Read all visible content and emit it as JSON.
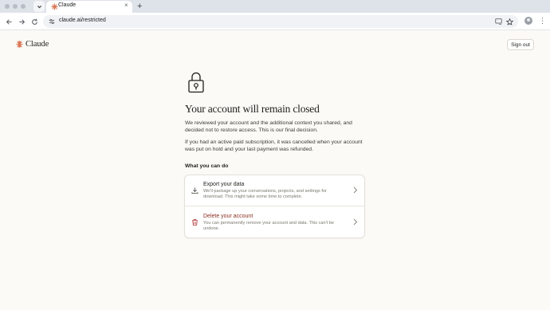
{
  "browser": {
    "tab_title": "Claude",
    "tab_close": "×",
    "new_tab": "+",
    "url": "claude.ai/restricted",
    "menu": "⋮"
  },
  "header": {
    "logo_text": "Claude",
    "sign_out_label": "Sign out"
  },
  "main": {
    "title": "Your account will remain closed",
    "paragraph_1": "We reviewed your account and the additional context you shared, and decided not to restore access. This is our final decision.",
    "paragraph_2": "If you had an active paid subscription, it was cancelled when your account was put on hold and your last payment was refunded.",
    "section_label": "What you can do",
    "options": [
      {
        "title": "Export your data",
        "description": "We'll package up your conversations, projects, and settings for download. This might take some time to complete.",
        "icon": "download-icon"
      },
      {
        "title": "Delete your account",
        "description": "You can permanently remove your account and data. This can't be undone.",
        "icon": "trash-icon"
      }
    ]
  },
  "colors": {
    "accent": "#d97757",
    "danger": "#8c2f20",
    "background": "#fbfaf6"
  }
}
